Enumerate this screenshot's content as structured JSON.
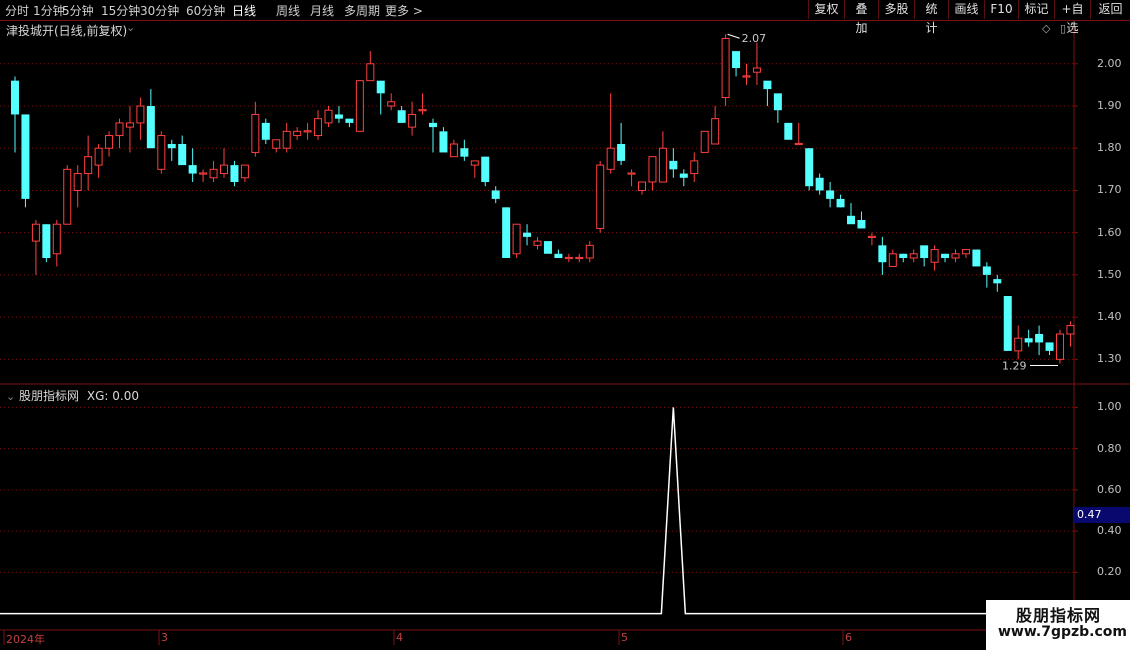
{
  "toolbar": {
    "periods": [
      "分时",
      "1分钟",
      "5分钟",
      "15分钟",
      "30分钟",
      "60分钟",
      "日线",
      "周线",
      "月线",
      "多周期",
      "更多 >"
    ],
    "active_period": "日线",
    "buttons": [
      "复权",
      "叠加",
      "多股",
      "统计",
      "画线",
      "F10",
      "标记",
      "+自选",
      "返回"
    ]
  },
  "main_panel": {
    "stock_title": "津投城开(日线,前复权)",
    "high_label": "2.07",
    "low_label": "1.29"
  },
  "indicator_panel": {
    "title": "股朋指标网",
    "value_label": "XG: 0.00",
    "current_value": "0.47"
  },
  "watermark": {
    "title": "股朋指标网",
    "url": "www.7gpzb.com"
  },
  "colors": {
    "up": "#ff4040",
    "down": "#54ffff",
    "grid": "#7a1212",
    "indicator_line": "#ffffff"
  },
  "chart_data": [
    {
      "type": "candlestick",
      "title": "津投城开(日线,前复权)",
      "y_ticks": [
        2.0,
        1.9,
        1.8,
        1.7,
        1.6,
        1.5,
        1.4,
        1.3
      ],
      "ylim": [
        1.27,
        2.08
      ],
      "x_labels": [
        "2024年",
        "3",
        "4",
        "5",
        "6"
      ],
      "annotations": [
        {
          "text": "2.07",
          "type": "high"
        },
        {
          "text": "1.29",
          "type": "low"
        }
      ],
      "ohlc": [
        [
          1.96,
          1.97,
          1.79,
          1.88
        ],
        [
          1.88,
          1.88,
          1.66,
          1.68
        ],
        [
          1.58,
          1.63,
          1.5,
          1.62
        ],
        [
          1.62,
          1.62,
          1.53,
          1.54
        ],
        [
          1.55,
          1.63,
          1.52,
          1.62
        ],
        [
          1.62,
          1.76,
          1.62,
          1.75
        ],
        [
          1.7,
          1.76,
          1.66,
          1.74
        ],
        [
          1.74,
          1.83,
          1.7,
          1.78
        ],
        [
          1.76,
          1.81,
          1.73,
          1.8
        ],
        [
          1.8,
          1.84,
          1.78,
          1.83
        ],
        [
          1.83,
          1.87,
          1.8,
          1.86
        ],
        [
          1.85,
          1.9,
          1.79,
          1.86
        ],
        [
          1.86,
          1.92,
          1.82,
          1.9
        ],
        [
          1.9,
          1.94,
          1.8,
          1.8
        ],
        [
          1.75,
          1.84,
          1.74,
          1.83
        ],
        [
          1.81,
          1.82,
          1.77,
          1.8
        ],
        [
          1.81,
          1.83,
          1.77,
          1.76
        ],
        [
          1.76,
          1.8,
          1.72,
          1.74
        ],
        [
          1.74,
          1.75,
          1.72,
          1.74
        ],
        [
          1.73,
          1.77,
          1.72,
          1.75
        ],
        [
          1.74,
          1.8,
          1.73,
          1.76
        ],
        [
          1.76,
          1.77,
          1.71,
          1.72
        ],
        [
          1.73,
          1.76,
          1.72,
          1.76
        ],
        [
          1.79,
          1.91,
          1.78,
          1.88
        ],
        [
          1.86,
          1.87,
          1.81,
          1.82
        ],
        [
          1.8,
          1.81,
          1.79,
          1.82
        ],
        [
          1.8,
          1.86,
          1.79,
          1.84
        ],
        [
          1.83,
          1.85,
          1.82,
          1.84
        ],
        [
          1.84,
          1.86,
          1.82,
          1.84
        ],
        [
          1.83,
          1.89,
          1.82,
          1.87
        ],
        [
          1.86,
          1.9,
          1.85,
          1.89
        ],
        [
          1.88,
          1.9,
          1.86,
          1.87
        ],
        [
          1.87,
          1.87,
          1.85,
          1.86
        ],
        [
          1.84,
          1.9,
          1.85,
          1.96
        ],
        [
          1.96,
          2.03,
          1.96,
          2.0
        ],
        [
          1.96,
          1.93,
          1.88,
          1.93
        ],
        [
          1.9,
          1.93,
          1.89,
          1.91
        ],
        [
          1.89,
          1.9,
          1.87,
          1.86
        ],
        [
          1.85,
          1.91,
          1.83,
          1.88
        ],
        [
          1.89,
          1.93,
          1.88,
          1.89
        ],
        [
          1.86,
          1.87,
          1.79,
          1.85
        ],
        [
          1.84,
          1.85,
          1.82,
          1.79
        ],
        [
          1.78,
          1.82,
          1.78,
          1.81
        ],
        [
          1.8,
          1.82,
          1.77,
          1.78
        ],
        [
          1.76,
          1.77,
          1.73,
          1.77
        ],
        [
          1.78,
          1.78,
          1.71,
          1.72
        ],
        [
          1.7,
          1.71,
          1.67,
          1.68
        ],
        [
          1.66,
          1.66,
          1.54,
          1.54
        ],
        [
          1.55,
          1.62,
          1.54,
          1.62
        ],
        [
          1.6,
          1.62,
          1.57,
          1.59
        ],
        [
          1.57,
          1.59,
          1.56,
          1.58
        ],
        [
          1.58,
          1.58,
          1.56,
          1.55
        ],
        [
          1.55,
          1.56,
          1.54,
          1.54
        ],
        [
          1.54,
          1.55,
          1.53,
          1.54
        ],
        [
          1.54,
          1.55,
          1.53,
          1.54
        ],
        [
          1.54,
          1.58,
          1.53,
          1.57
        ],
        [
          1.61,
          1.77,
          1.6,
          1.76
        ],
        [
          1.75,
          1.93,
          1.74,
          1.8
        ],
        [
          1.81,
          1.86,
          1.76,
          1.77
        ],
        [
          1.74,
          1.75,
          1.71,
          1.74
        ],
        [
          1.7,
          1.72,
          1.69,
          1.72
        ],
        [
          1.72,
          1.78,
          1.7,
          1.78
        ],
        [
          1.72,
          1.84,
          1.72,
          1.8
        ],
        [
          1.77,
          1.8,
          1.73,
          1.75
        ],
        [
          1.74,
          1.75,
          1.71,
          1.73
        ],
        [
          1.74,
          1.79,
          1.72,
          1.77
        ],
        [
          1.79,
          1.84,
          1.79,
          1.84
        ],
        [
          1.81,
          1.9,
          1.81,
          1.87
        ],
        [
          1.92,
          2.07,
          1.9,
          2.06
        ],
        [
          2.03,
          2.02,
          1.97,
          1.99
        ],
        [
          1.97,
          2.0,
          1.95,
          1.97
        ],
        [
          1.98,
          2.05,
          1.95,
          1.99
        ],
        [
          1.96,
          1.95,
          1.9,
          1.94
        ],
        [
          1.93,
          1.92,
          1.86,
          1.89
        ],
        [
          1.86,
          1.86,
          1.83,
          1.82
        ],
        [
          1.81,
          1.86,
          1.81,
          1.81
        ],
        [
          1.8,
          1.8,
          1.7,
          1.71
        ],
        [
          1.73,
          1.74,
          1.69,
          1.7
        ],
        [
          1.7,
          1.72,
          1.66,
          1.68
        ],
        [
          1.68,
          1.69,
          1.66,
          1.66
        ],
        [
          1.64,
          1.67,
          1.64,
          1.62
        ],
        [
          1.63,
          1.65,
          1.61,
          1.61
        ],
        [
          1.59,
          1.6,
          1.57,
          1.59
        ],
        [
          1.57,
          1.59,
          1.5,
          1.53
        ],
        [
          1.52,
          1.56,
          1.52,
          1.55
        ],
        [
          1.55,
          1.55,
          1.53,
          1.54
        ],
        [
          1.54,
          1.56,
          1.53,
          1.55
        ],
        [
          1.57,
          1.56,
          1.52,
          1.54
        ],
        [
          1.53,
          1.57,
          1.51,
          1.56
        ],
        [
          1.55,
          1.55,
          1.53,
          1.54
        ],
        [
          1.54,
          1.56,
          1.53,
          1.55
        ],
        [
          1.55,
          1.56,
          1.54,
          1.56
        ],
        [
          1.56,
          1.56,
          1.52,
          1.52
        ],
        [
          1.52,
          1.53,
          1.47,
          1.5
        ],
        [
          1.49,
          1.5,
          1.46,
          1.48
        ],
        [
          1.45,
          1.45,
          1.32,
          1.32
        ],
        [
          1.32,
          1.38,
          1.3,
          1.35
        ],
        [
          1.35,
          1.37,
          1.33,
          1.34
        ],
        [
          1.36,
          1.38,
          1.31,
          1.34
        ],
        [
          1.34,
          1.34,
          1.31,
          1.32
        ],
        [
          1.3,
          1.37,
          1.29,
          1.36
        ],
        [
          1.36,
          1.39,
          1.33,
          1.38
        ]
      ]
    },
    {
      "type": "line",
      "title": "股朋指标网",
      "y_ticks": [
        1.0,
        0.8,
        0.6,
        0.4,
        0.2
      ],
      "ylim": [
        -0.06,
        1.06
      ],
      "series": [
        {
          "name": "XG",
          "spike_index": 63,
          "spike_value": 1.0,
          "base_value": 0.0
        }
      ]
    }
  ]
}
